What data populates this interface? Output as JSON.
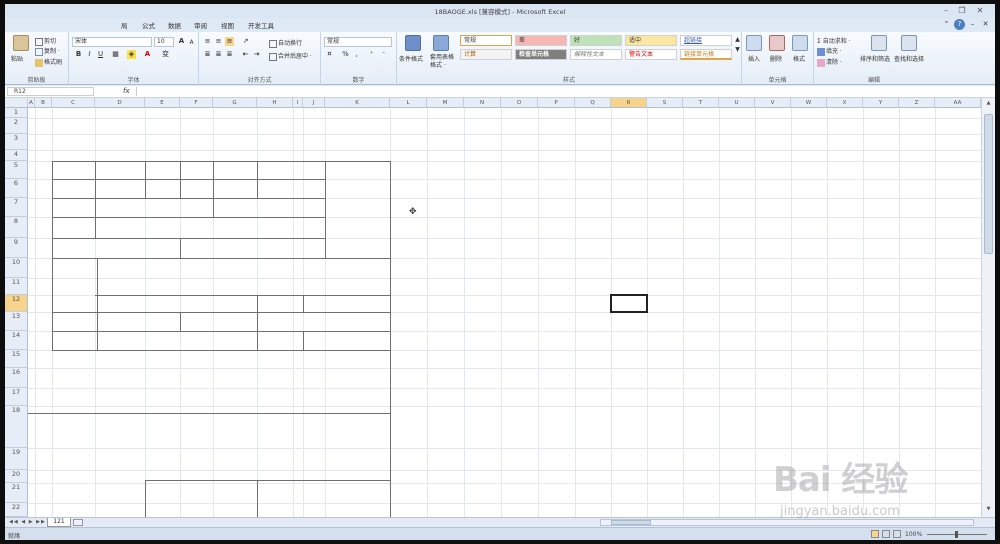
{
  "window": {
    "title": "18BAOGE.xls  [兼容模式]  -  Microsoft Excel",
    "min_label": "–",
    "restore_label": "❐",
    "close_label": "✕"
  },
  "menu": {
    "items": [
      "局",
      "公式",
      "数据",
      "审阅",
      "视图",
      "开发工具"
    ],
    "help_label": "?"
  },
  "ribbon": {
    "clipboard": {
      "paste": "粘贴",
      "cut": "剪切",
      "copy": "复制 ·",
      "format_painter": "格式刷",
      "label": "剪贴板"
    },
    "font": {
      "name": "宋体",
      "size": "10",
      "bold": "B",
      "italic": "I",
      "underline": "U",
      "grow": "A",
      "shrink": "A",
      "phonetic": "变",
      "font_color": "A",
      "label": "字体"
    },
    "alignment": {
      "wrap": "自动换行",
      "merge": "合并后居中 ·",
      "label": "对齐方式"
    },
    "number": {
      "format": "常规",
      "percent": "%",
      "comma": ",",
      "label": "数字"
    },
    "styles": {
      "cond_format": "条件格式",
      "table_format": "套用表格格式 ·",
      "items": [
        "常规",
        "差",
        "好",
        "适中",
        "超链接",
        "计算",
        "检查单元格",
        "解释性文本",
        "警告文本",
        "链接单元格"
      ],
      "label": "样式"
    },
    "cells": {
      "insert": "插入",
      "delete": "删除",
      "format": "格式",
      "label": "单元格"
    },
    "editing": {
      "autosum": "Σ 自动求和 ·",
      "fill": "填充 ·",
      "clear": "清除 ·",
      "sort": "排序和筛选",
      "find": "查找和选择",
      "label": "编辑"
    }
  },
  "formula_bar": {
    "cell_ref": "R12",
    "fx": "fx",
    "content": ""
  },
  "columns": [
    "A",
    "B",
    "C",
    "D",
    "E",
    "F",
    "G",
    "H",
    "I",
    "J",
    "K",
    "L",
    "M",
    "N",
    "O",
    "P",
    "Q",
    "R",
    "S",
    "T",
    "U",
    "V",
    "W",
    "X",
    "Y",
    "Z",
    "AA"
  ],
  "rows": [
    "1",
    "2",
    "3",
    "4",
    "5",
    "6",
    "7",
    "8",
    "9",
    "10",
    "11",
    "12",
    "13",
    "14",
    "15",
    "16",
    "17",
    "18",
    "19",
    "20",
    "21",
    "22"
  ],
  "sheet_tab": "121",
  "status": {
    "ready": "就绪",
    "zoom": "100%"
  },
  "watermark": {
    "main": "Bai 经验",
    "url": "jingyan.baidu.com"
  },
  "colors": {
    "accent": "#dfe9f5",
    "selected_header": "#f6d48c",
    "style_bad": "#f4b7b4",
    "style_good": "#bfe3b8",
    "style_neutral": "#fce7a2"
  }
}
